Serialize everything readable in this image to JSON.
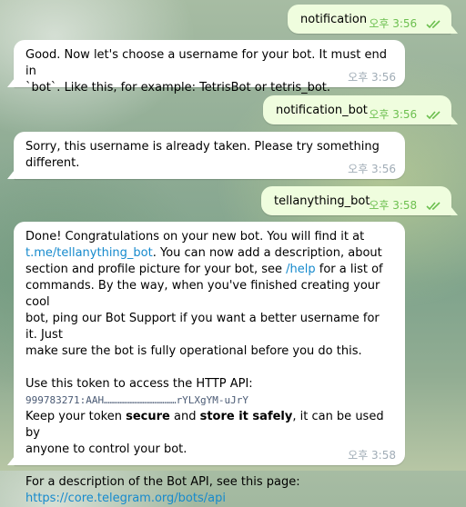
{
  "messages": [
    {
      "type": "out",
      "text": "notification",
      "time": "오후 3:56"
    },
    {
      "type": "in",
      "text_1": "Good. Now let's choose a username for your bot. It must end in",
      "text_2": "`bot`. Like this, for example: TetrisBot or tetris_bot.",
      "time": "오후 3:56"
    },
    {
      "type": "out",
      "text": "notification_bot",
      "time": "오후 3:56"
    },
    {
      "type": "in",
      "text_1": "Sorry, this username is already taken. Please try something",
      "text_2": "different.",
      "time": "오후 3:56"
    },
    {
      "type": "out",
      "text": "tellanything_bot",
      "time": "오후 3:58"
    },
    {
      "type": "in",
      "time": "오후 3:58",
      "line_1": "Done! Congratulations on your new bot. You will find it at",
      "link_username": "t.me/tellanything_bot",
      "line_2_rest": ". You can now add a description, about",
      "line_3": "section and profile picture for your bot, see ",
      "help_link": "/help",
      "line_3_rest": " for a list of",
      "line_4": "commands. By the way, when you've finished creating your cool",
      "line_5": "bot, ping our Bot Support if you want a better username for it. Just",
      "line_6": "make sure the bot is fully operational before you do this.",
      "token_label": "Use this token to access the HTTP API:",
      "token": "999783271:AAH………………………………rYLXgYM-uJrY",
      "keep_1": "Keep your token ",
      "keep_secure": "secure",
      "keep_and": " and ",
      "keep_store": "store it safely",
      "keep_rest": ", it can be used by",
      "keep_2": "anyone to control your bot.",
      "api_line": "For a description of the Bot API, see this page:",
      "api_link": "https://core.telegram.org/bots/api"
    }
  ],
  "colors": {
    "outgoing_bubble": "#effdde",
    "incoming_bubble": "#ffffff",
    "link": "#168acd",
    "read_check": "#6cbf4f"
  },
  "icons": {
    "read_receipt": "double-check-icon"
  }
}
